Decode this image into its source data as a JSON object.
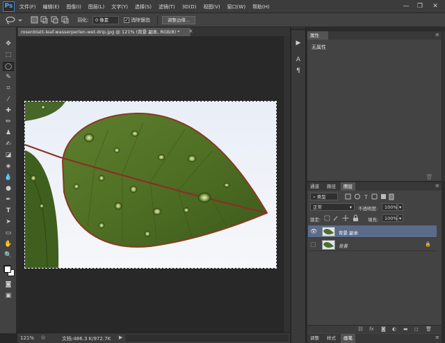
{
  "app": {
    "logo": "Ps"
  },
  "menu": [
    "文件(F)",
    "编辑(E)",
    "图像(I)",
    "图层(L)",
    "文字(Y)",
    "选择(S)",
    "滤镜(T)",
    "3D(D)",
    "视图(V)",
    "窗口(W)",
    "帮助(H)"
  ],
  "window_controls": {
    "minimize": "—",
    "restore": "❐",
    "close": "✕"
  },
  "options": {
    "feather_label": "羽化:",
    "feather_value": "0 像素",
    "antialias_label": "消除锯齿",
    "antialias_checked": true,
    "refine_edge_button": "调整边缘..."
  },
  "document": {
    "tab_title": "rosenblatt-leaf-wasserperlen-wet-drip.jpg @ 121% (背景 副本, RGB/8) *",
    "close": "×"
  },
  "status": {
    "zoom": "121%",
    "doc_info": "文档:486.3 K/972.7K"
  },
  "properties_panel": {
    "tab": "属性",
    "empty_text": "无属性"
  },
  "layers_panel": {
    "tabs": [
      "通道",
      "路径",
      "图层"
    ],
    "active_tab": "图层",
    "filter_kind": "类型",
    "blend_mode": "正常",
    "opacity_label": "不透明度:",
    "opacity_value": "100%",
    "lock_label": "锁定:",
    "fill_label": "填充:",
    "fill_value": "100%",
    "layers": [
      {
        "name": "背景 副本",
        "visible": true,
        "selected": true,
        "locked": false
      },
      {
        "name": "背景",
        "visible": false,
        "selected": false,
        "locked": true
      }
    ]
  },
  "bottom_tabs": [
    "调整",
    "样式",
    "画笔"
  ],
  "bottom_active_tab": "画笔"
}
